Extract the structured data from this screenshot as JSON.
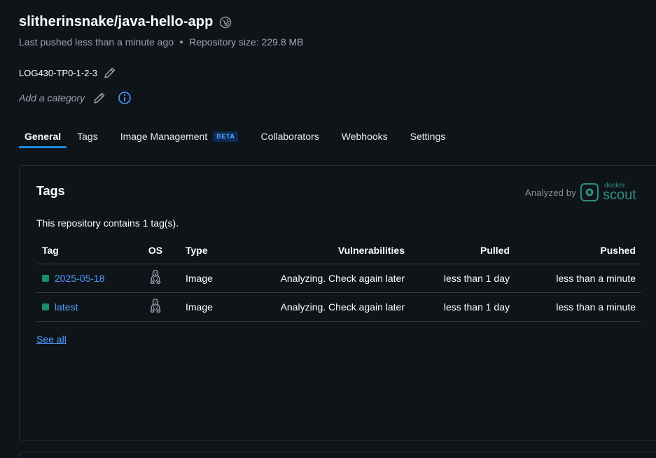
{
  "repo": {
    "name": "slitherinsnake/java-hello-app",
    "last_pushed": "Last pushed less than a minute ago",
    "size": "Repository size: 229.8 MB",
    "description": "LOG430-TP0-1-2-3",
    "category_placeholder": "Add a category"
  },
  "tabs": [
    {
      "label": "General",
      "active": true
    },
    {
      "label": "Tags"
    },
    {
      "label": "Image Management",
      "badge": "BETA"
    },
    {
      "label": "Collaborators"
    },
    {
      "label": "Webhooks"
    },
    {
      "label": "Settings"
    }
  ],
  "tags_panel": {
    "title": "Tags",
    "analyzed_by": "Analyzed by",
    "scout_brand_top": "docker",
    "scout_brand_name": "scout",
    "count_text": "This repository contains 1 tag(s).",
    "columns": [
      "Tag",
      "OS",
      "Type",
      "Vulnerabilities",
      "Pulled",
      "Pushed"
    ],
    "rows": [
      {
        "tag": "2025-05-18",
        "os_icon": "linux-icon",
        "type": "Image",
        "vulnerabilities": "Analyzing. Check again later",
        "pulled": "less than 1 day",
        "pushed": "less than a minute"
      },
      {
        "tag": "latest",
        "os_icon": "linux-icon",
        "type": "Image",
        "vulnerabilities": "Analyzing. Check again later",
        "pulled": "less than 1 day",
        "pushed": "less than a minute"
      }
    ],
    "see_all": "See all"
  },
  "colors": {
    "background": "#0f1419",
    "accent": "#1d8ce0",
    "link": "#4f9dff",
    "tag_square": "#1f8a72",
    "scout": "#2b8f83"
  }
}
